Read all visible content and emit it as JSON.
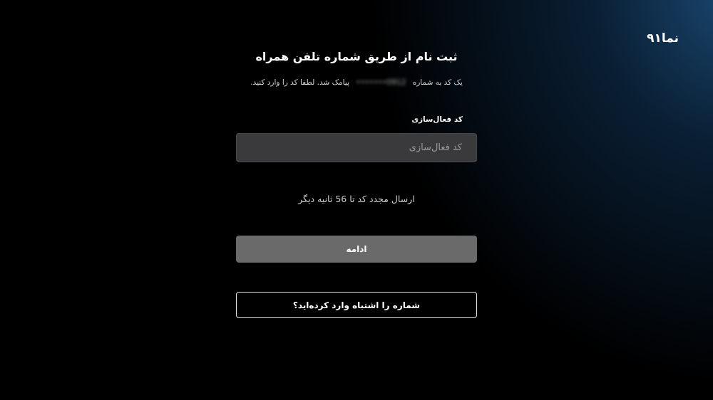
{
  "brand": {
    "logo_text": "نما۹۱"
  },
  "signup": {
    "title": "ثبت نام از طریق شماره تلفن همراه",
    "subtitle_before": "یک کد به شماره",
    "phone_masked": "‎0912•••••••",
    "subtitle_after": "پیامک شد. لطفا کد را وارد کنید.",
    "code_label": "کد فعال‌سازی",
    "code_placeholder": "کد فعال‌سازی",
    "code_value": "",
    "resend_text": "ارسال مجدد کد تا 56 ثانیه دیگر",
    "continue_label": "ادامه",
    "wrong_number_label": "شماره را اشتباه وارد کرده‌اید؟"
  },
  "colors": {
    "background": "#000000",
    "accent_glow": "#1c4e7a",
    "input_bg": "#3a3a3d",
    "button_disabled": "#6a6a6a"
  }
}
